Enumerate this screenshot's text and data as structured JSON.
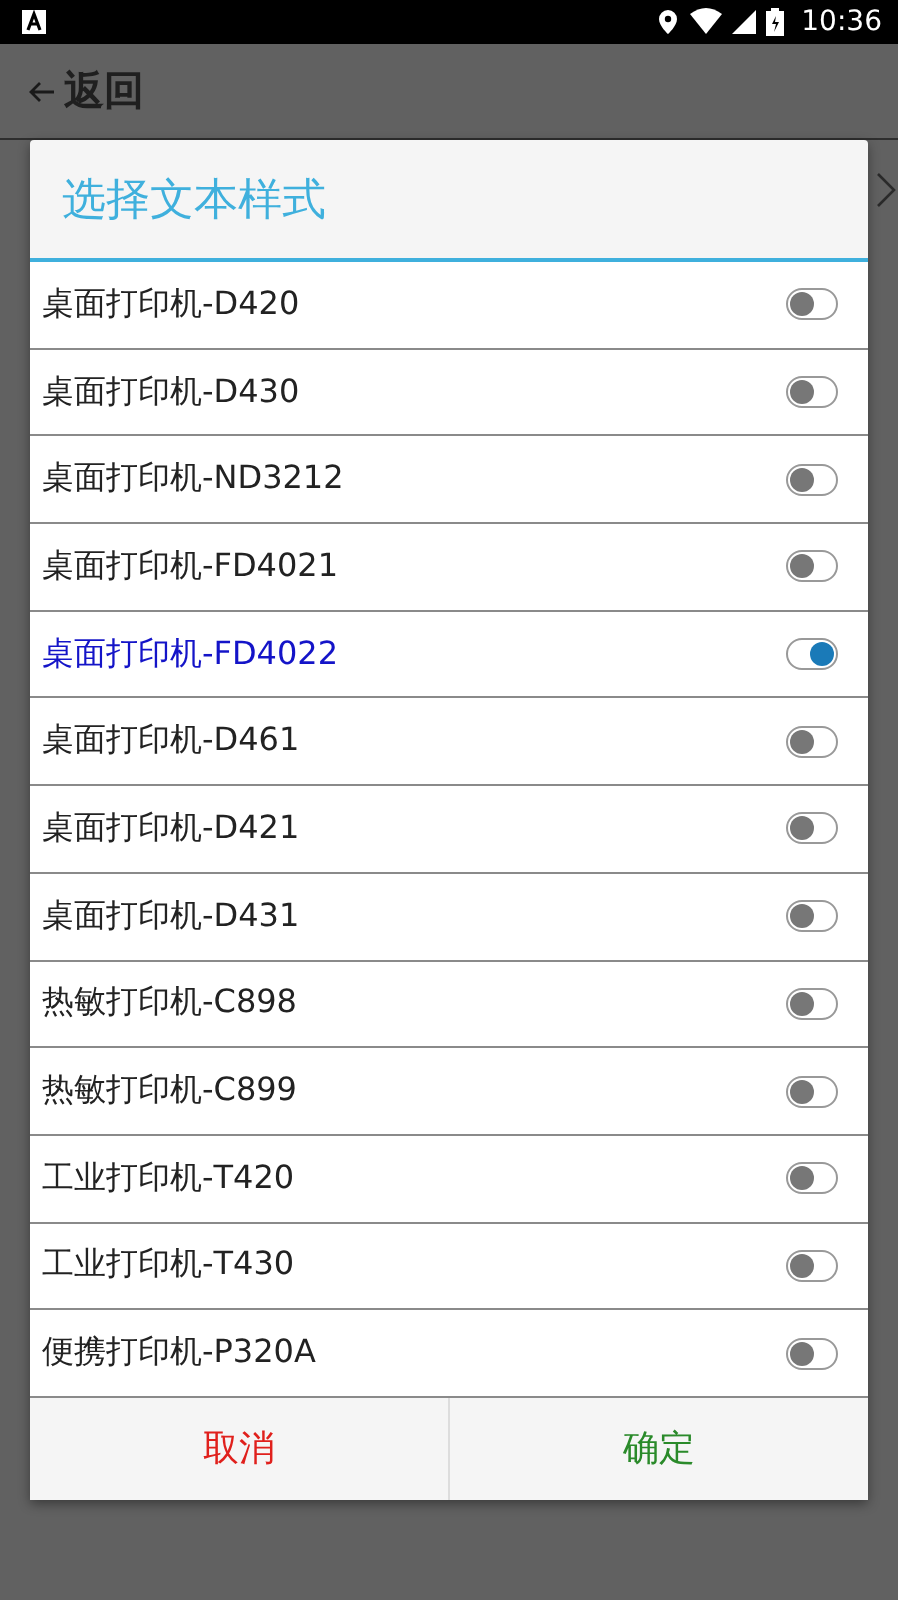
{
  "status_bar": {
    "time": "10:36"
  },
  "app_bar": {
    "back_label": "返回"
  },
  "dialog": {
    "title": "选择文本样式",
    "options": [
      {
        "label": "桌面打印机-D420",
        "selected": false
      },
      {
        "label": "桌面打印机-D430",
        "selected": false
      },
      {
        "label": "桌面打印机-ND3212",
        "selected": false
      },
      {
        "label": "桌面打印机-FD4021",
        "selected": false
      },
      {
        "label": "桌面打印机-FD4022",
        "selected": true
      },
      {
        "label": "桌面打印机-D461",
        "selected": false
      },
      {
        "label": "桌面打印机-D421",
        "selected": false
      },
      {
        "label": "桌面打印机-D431",
        "selected": false
      },
      {
        "label": "热敏打印机-C898",
        "selected": false
      },
      {
        "label": "热敏打印机-C899",
        "selected": false
      },
      {
        "label": "工业打印机-T420",
        "selected": false
      },
      {
        "label": "工业打印机-T430",
        "selected": false
      },
      {
        "label": "便携打印机-P320A",
        "selected": false
      }
    ],
    "buttons": [
      {
        "label": "取消",
        "kind": "cancel"
      },
      {
        "label": "确定",
        "kind": "confirm"
      }
    ]
  }
}
